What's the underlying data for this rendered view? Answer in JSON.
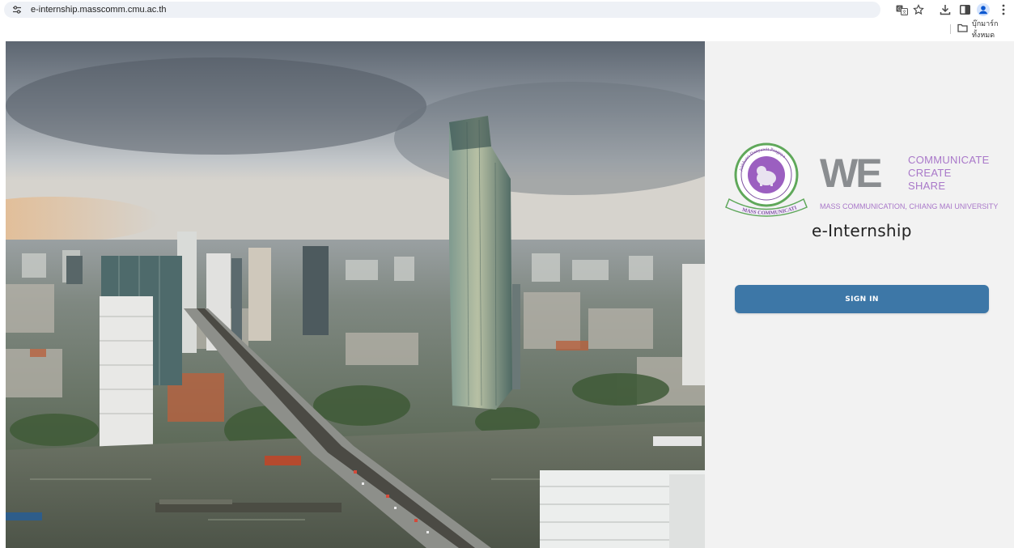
{
  "browser": {
    "url": "e-internship.masscomm.cmu.ac.th",
    "bookmarks_folder_label": "บุ๊กมาร์กทั้งหมด",
    "icons": [
      "site-info-icon",
      "translate-icon",
      "bookmark-star-icon",
      "download-icon",
      "side-panel-icon",
      "profile-icon",
      "menu-icon",
      "folder-icon"
    ]
  },
  "hero": {
    "image": "city-skyline-river-photo"
  },
  "branding": {
    "seal_text_top": "Ahbhatri Danyawit Pragnya",
    "seal_ribbon": "MASS COMMUNICATION",
    "we": "WE",
    "we_words": [
      "COMMUNICATE",
      "CREATE",
      "SHARE"
    ],
    "subtitle": "MASS COMMUNICATION, CHIANG MAI UNIVERSITY",
    "purple": "#a978c9",
    "grey": "#8a8d90"
  },
  "app": {
    "title": "e-Internship",
    "sign_in_label": "SIGN IN",
    "accent": "#3d77a7"
  }
}
